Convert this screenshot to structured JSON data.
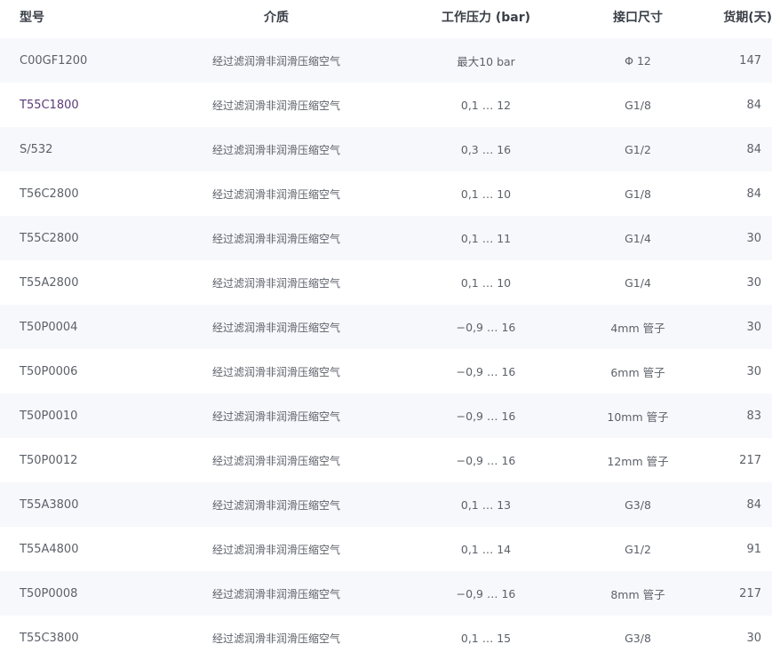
{
  "headers": {
    "model": "型号",
    "medium": "介质",
    "pressure": "工作压力 (bar)",
    "port": "接口尺寸",
    "lead": "货期(天)"
  },
  "rows": [
    {
      "model": "C00GF1200",
      "medium": "经过滤润滑非润滑压缩空气",
      "pressure": "最大10 bar",
      "port": "Φ 12",
      "lead": "147"
    },
    {
      "model": "T55C1800",
      "medium": "经过滤润滑非润滑压缩空气",
      "pressure": "0,1 … 12",
      "port": "G1/8",
      "lead": "84"
    },
    {
      "model": "S/532",
      "medium": "经过滤润滑非润滑压缩空气",
      "pressure": "0,3 … 16",
      "port": "G1/2",
      "lead": "84"
    },
    {
      "model": "T56C2800",
      "medium": "经过滤润滑非润滑压缩空气",
      "pressure": "0,1 … 10",
      "port": "G1/8",
      "lead": "84"
    },
    {
      "model": "T55C2800",
      "medium": "经过滤润滑非润滑压缩空气",
      "pressure": "0,1 … 11",
      "port": "G1/4",
      "lead": "30"
    },
    {
      "model": "T55A2800",
      "medium": "经过滤润滑非润滑压缩空气",
      "pressure": "0,1 … 10",
      "port": "G1/4",
      "lead": "30"
    },
    {
      "model": "T50P0004",
      "medium": "经过滤润滑非润滑压缩空气",
      "pressure": "−0,9 … 16",
      "port": "4mm 管子",
      "lead": "30"
    },
    {
      "model": "T50P0006",
      "medium": "经过滤润滑非润滑压缩空气",
      "pressure": "−0,9 … 16",
      "port": "6mm 管子",
      "lead": "30"
    },
    {
      "model": "T50P0010",
      "medium": "经过滤润滑非润滑压缩空气",
      "pressure": "−0,9 … 16",
      "port": "10mm 管子",
      "lead": "83"
    },
    {
      "model": "T50P0012",
      "medium": "经过滤润滑非润滑压缩空气",
      "pressure": "−0,9 … 16",
      "port": "12mm 管子",
      "lead": "217"
    },
    {
      "model": "T55A3800",
      "medium": "经过滤润滑非润滑压缩空气",
      "pressure": "0,1 … 13",
      "port": "G3/8",
      "lead": "84"
    },
    {
      "model": "T55A4800",
      "medium": "经过滤润滑非润滑压缩空气",
      "pressure": "0,1 … 14",
      "port": "G1/2",
      "lead": "91"
    },
    {
      "model": "T50P0008",
      "medium": "经过滤润滑非润滑压缩空气",
      "pressure": "−0,9 … 16",
      "port": "8mm 管子",
      "lead": "217"
    },
    {
      "model": "T55C3800",
      "medium": "经过滤润滑非润滑压缩空气",
      "pressure": "0,1 … 15",
      "port": "G3/8",
      "lead": "30"
    }
  ],
  "colors": {
    "header_text": "#3a3f47",
    "row_text": "#5c6169",
    "row_alt_bg": "#f7f8fb",
    "link_text": "#5b3a78"
  }
}
